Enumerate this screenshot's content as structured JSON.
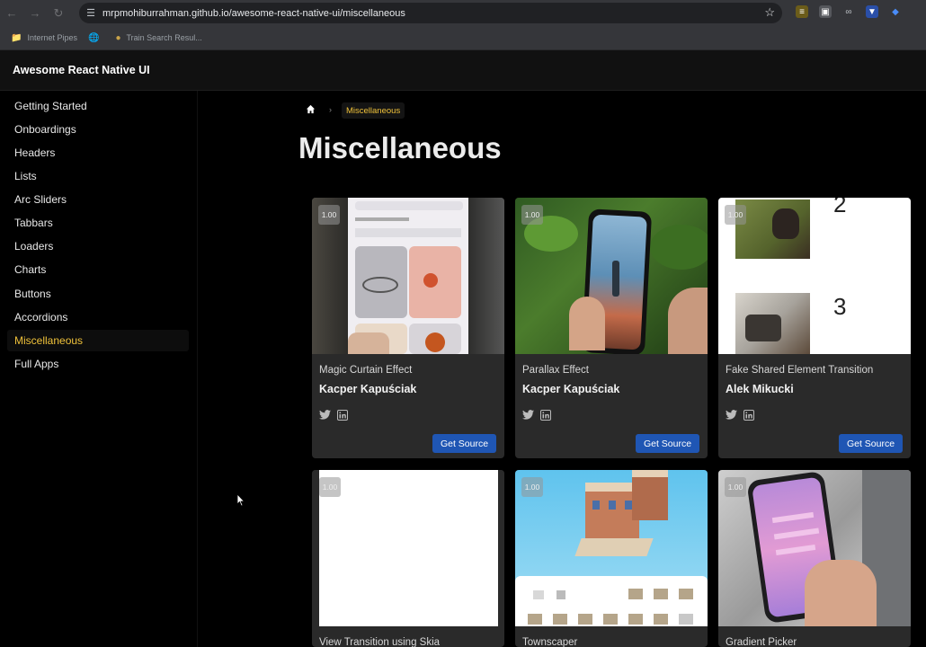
{
  "browser": {
    "url": "mrpmohiburrahman.github.io/awesome-react-native-ui/miscellaneous",
    "bookmarks": [
      {
        "label": "Internet Pipes",
        "icon": "folder-icon"
      },
      {
        "label": "",
        "icon": "globe-icon"
      },
      {
        "label": "Train Search Resul...",
        "icon": "train-icon"
      }
    ]
  },
  "app": {
    "title": "Awesome React Native UI"
  },
  "sidebar": {
    "items": [
      {
        "label": "Getting Started"
      },
      {
        "label": "Onboardings"
      },
      {
        "label": "Headers"
      },
      {
        "label": "Lists"
      },
      {
        "label": "Arc Sliders"
      },
      {
        "label": "Tabbars"
      },
      {
        "label": "Loaders"
      },
      {
        "label": "Charts"
      },
      {
        "label": "Buttons"
      },
      {
        "label": "Accordions"
      },
      {
        "label": "Miscellaneous",
        "active": true
      },
      {
        "label": "Full Apps"
      }
    ]
  },
  "breadcrumb": {
    "current": "Miscellaneous"
  },
  "page": {
    "title": "Miscellaneous"
  },
  "cards": [
    {
      "name": "Magic Curtain Effect",
      "author": "Kacper Kapuściak",
      "speed": "1.00",
      "button": "Get Source"
    },
    {
      "name": "Parallax Effect",
      "author": "Kacper Kapuściak",
      "speed": "1.00",
      "button": "Get Source"
    },
    {
      "name": "Fake Shared Element Transition",
      "author": "Alek Mikucki",
      "speed": "1.00",
      "button": "Get Source",
      "thumb_numbers": [
        "2",
        "3"
      ]
    },
    {
      "name": "View Transition using Skia",
      "author": "",
      "speed": "1.00",
      "button": ""
    },
    {
      "name": "Townscaper",
      "author": "",
      "speed": "1.00",
      "button": ""
    },
    {
      "name": "Gradient Picker",
      "author": "",
      "speed": "1.00",
      "button": ""
    }
  ],
  "colors": {
    "accent": "#f0c23a",
    "button": "#1f56b4",
    "card": "#2a2a2a"
  }
}
